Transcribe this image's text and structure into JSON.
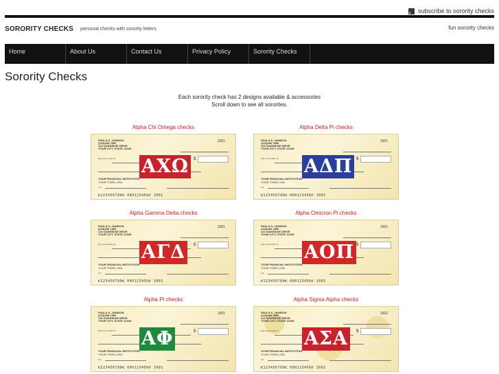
{
  "header": {
    "subscribe": "subscribe to sorority checks",
    "site_name": "SORORITY CHECKS",
    "tagline": "personal checks with sorority letters",
    "right_link": "fun sorority checks"
  },
  "nav": [
    "Home",
    "About Us",
    "Contact Us",
    "Privacy Policy",
    "Sorority Checks"
  ],
  "page": {
    "title": "Sorority Checks",
    "intro_line1": "Each sorority check has 2 designs available & accessories",
    "intro_line2": "Scroll down to see all sororites."
  },
  "check_template": {
    "name": "PAULA S. JAMISON",
    "address1": "(123)456-7890",
    "address2": "123 OAKRIDGE DRIVE",
    "address3": "YOUR CITY, STATE 12345",
    "pay_to": "Pay to the Order of",
    "bank": "YOUR FINANCIAL INSTITUTION",
    "bank_city": "YOUR TOWN, USA",
    "memo": "For",
    "dollar": "$",
    "micr": "⑆123456780⑆ 000123456⑈ 1001"
  },
  "checks": [
    {
      "title": "Alpha Chi Omega checks",
      "letters": "ΑΧΩ",
      "color": "#c8232c",
      "number": "1001"
    },
    {
      "title": "Alpha Delta Pi checks",
      "letters": "ΑΔΠ",
      "color": "#2a3e9c",
      "number": "1001"
    },
    {
      "title": "Alpha Gamma Delta checks",
      "letters": "ΑΓΔ",
      "color": "#d02727",
      "number": "1001"
    },
    {
      "title": "Alpha Omicron Pi checks",
      "letters": "ΑΟΠ",
      "color": "#d02727",
      "number": "1001"
    },
    {
      "title": "Alpha Pi checks",
      "letters": "ΑΦ",
      "color": "#1f8a3a",
      "number": "1001"
    },
    {
      "title": "Alpha Sigma Alpha checks",
      "letters": "ΑΣΑ",
      "color": "#c8232c",
      "number": "1002"
    }
  ],
  "icons": {
    "subscribe": "rss-icon"
  }
}
